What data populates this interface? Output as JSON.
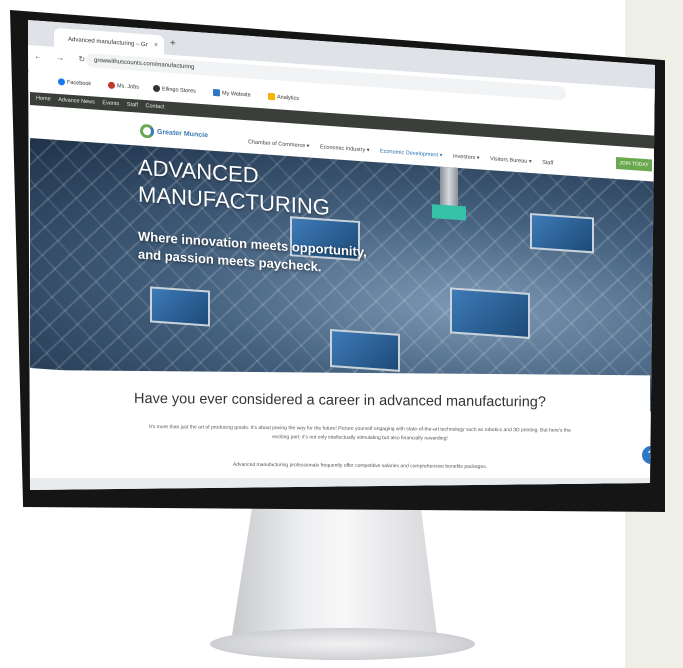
{
  "browser": {
    "tab_title": "Advanced manufacturing – Gr",
    "tab_close": "×",
    "new_tab": "+",
    "nav_icons": "← → ↻",
    "url": "growwithuscounts.com/manufacturing",
    "bookmarks": [
      "Facebook",
      "Ms. Jobs",
      "Ellingo Stores",
      "My Website",
      "Analytics"
    ]
  },
  "site": {
    "topnav": [
      "Home",
      "Advance News",
      "Events",
      "Staff",
      "Contact"
    ],
    "logo": "Greater Muncie",
    "menu": [
      "Chamber of Commerce ▾",
      "Economic Industry ▾",
      "Economic Development ▾",
      "Investors ▾",
      "Visitors Bureau ▾",
      "Staff"
    ],
    "menu_active_index": 2,
    "cta": "JOIN TODAY",
    "hero": {
      "title_line1": "ADVANCED",
      "title_line2": "MANUFACTURING",
      "subtitle_line1": "Where innovation meets opportunity,",
      "subtitle_line2": "and passion meets paycheck."
    },
    "headline": "Have you ever considered a career in advanced manufacturing?",
    "paragraph": "It's more than just the art of producing goods. It's about paving the way for the future! Picture yourself engaging with state-of-the-art technology such as robotics and 3D printing. But here's the exciting part: it's not only intellectually stimulating but also financially rewarding!",
    "paragraph2": "Advanced manufacturing professionals frequently offer competitive salaries and comprehensive benefits packages.",
    "help_icon": "?"
  },
  "colors": {
    "accent_green": "#6aa84f",
    "accent_blue": "#2e74b5",
    "topnav_bg": "#3b3f3a"
  }
}
